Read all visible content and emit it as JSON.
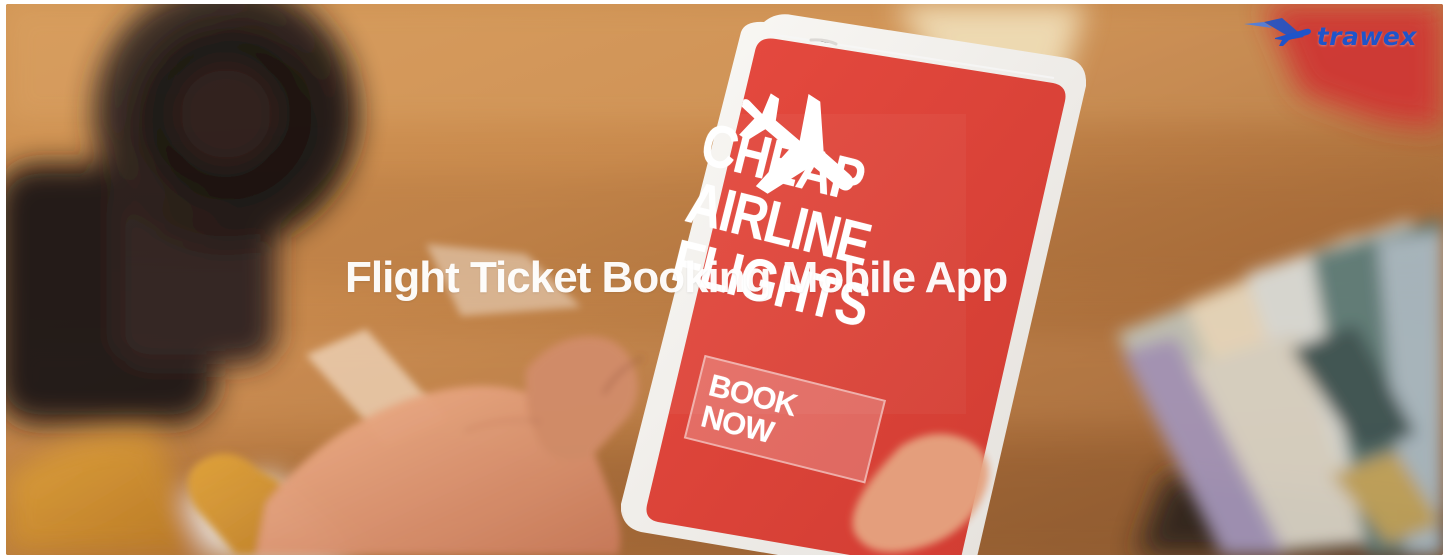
{
  "brand": {
    "name": "trawex",
    "icon": "plane-logo-icon",
    "color": "#1f54c9"
  },
  "headline": "Flight Ticket Booking Mobile App",
  "phone_screen": {
    "line1": "CHEAP",
    "line2": "AIRLINE",
    "line3": "FLIGHTS",
    "cta": "BOOK NOW",
    "icon": "airplane-icon",
    "color": "#d84136"
  }
}
